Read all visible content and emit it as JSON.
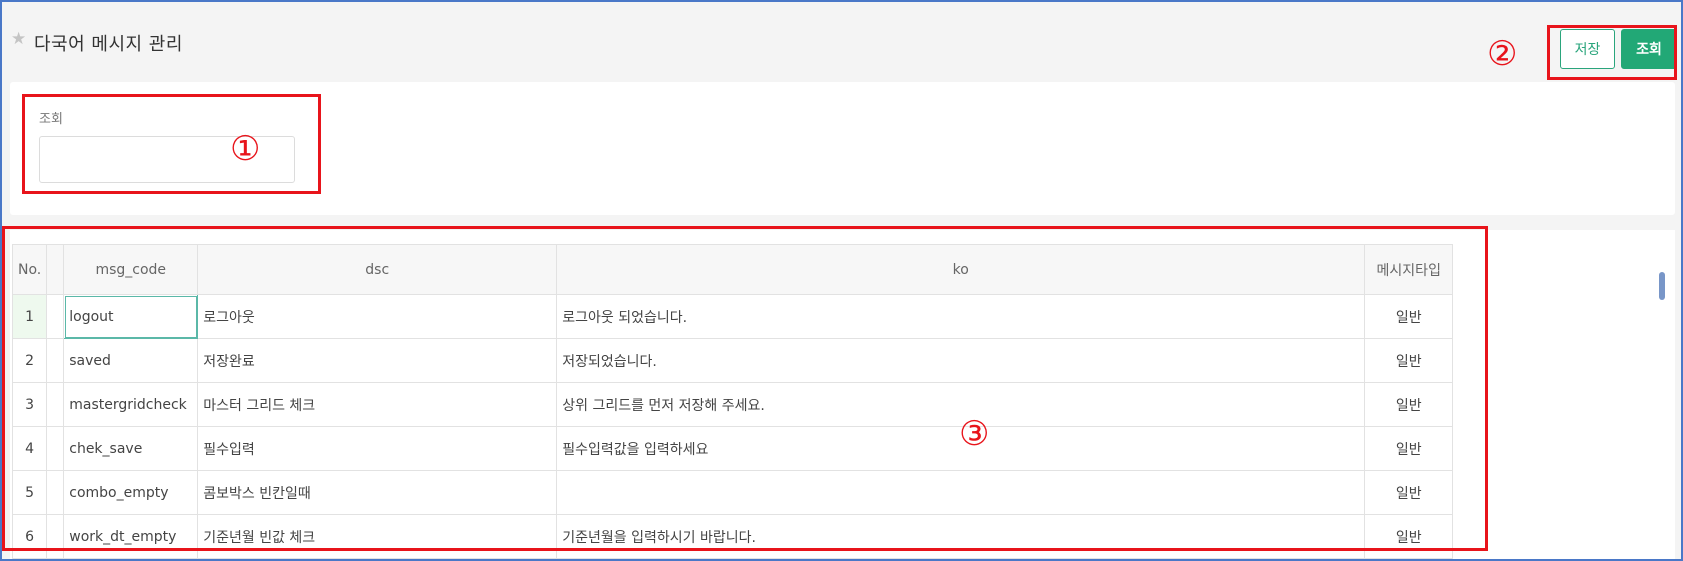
{
  "header": {
    "title": "다국어 메시지 관리",
    "star_icon": "star-icon",
    "save_label": "저장",
    "search_label": "조회"
  },
  "search_panel": {
    "label": "조회",
    "input_value": ""
  },
  "grid": {
    "columns": [
      "No.",
      "",
      "msg_code",
      "dsc",
      "ko",
      "메시지타입"
    ],
    "rows": [
      {
        "no": "1",
        "msg_code": "logout",
        "dsc": "로그아웃",
        "ko": "로그아웃 되었습니다.",
        "type": "일반"
      },
      {
        "no": "2",
        "msg_code": "saved",
        "dsc": "저장완료",
        "ko": "저장되었습니다.",
        "type": "일반"
      },
      {
        "no": "3",
        "msg_code": "mastergridcheck",
        "dsc": "마스터 그리드 체크",
        "ko": "상위 그리드를 먼저 저장해 주세요.",
        "type": "일반"
      },
      {
        "no": "4",
        "msg_code": "chek_save",
        "dsc": "필수입력",
        "ko": "필수입력값을 입력하세요",
        "type": "일반"
      },
      {
        "no": "5",
        "msg_code": "combo_empty",
        "dsc": "콤보박스 빈칸일때",
        "ko": "",
        "type": "일반"
      },
      {
        "no": "6",
        "msg_code": "work_dt_empty",
        "dsc": "기준년월 빈값 체크",
        "ko": "기준년월을 입력하시기 바랍니다.",
        "type": "일반"
      }
    ]
  },
  "annotations": [
    "①",
    "②",
    "③"
  ],
  "colors": {
    "accent": "#22a876",
    "annotation": "#e8141b",
    "window_border": "#4a78c8"
  }
}
